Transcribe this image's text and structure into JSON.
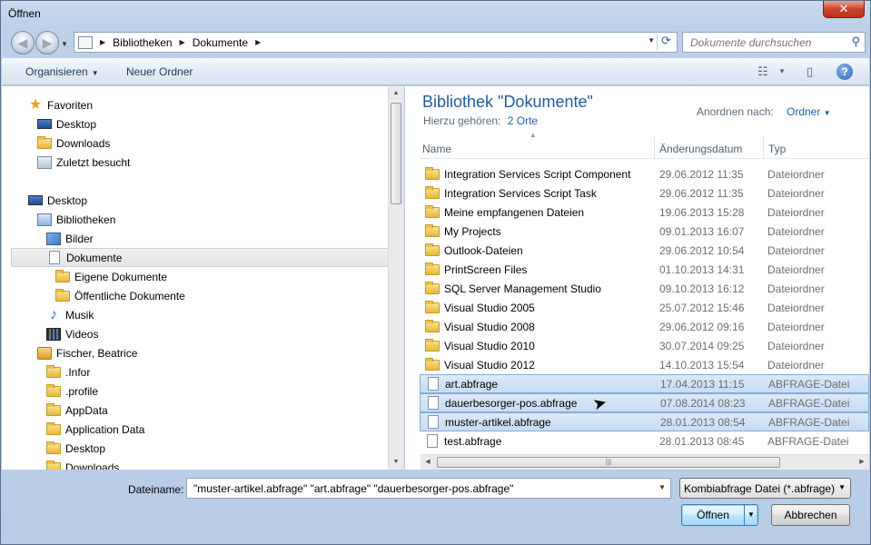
{
  "window": {
    "title": "Öffnen",
    "close_label": "✕"
  },
  "nav": {
    "back_label": "◀",
    "forward_label": "▶",
    "crumbs": [
      "Bibliotheken",
      "Dokumente"
    ],
    "search_placeholder": "Dokumente durchsuchen"
  },
  "toolbar": {
    "organize_label": "Organisieren",
    "new_folder_label": "Neuer Ordner",
    "help_label": "?"
  },
  "tree": [
    {
      "label": "Favoriten",
      "icon": "star-icon"
    },
    {
      "label": "Desktop",
      "icon": "monitor-icon"
    },
    {
      "label": "Downloads",
      "icon": "folder-icon"
    },
    {
      "label": "Zuletzt besucht",
      "icon": "recent-places-icon"
    },
    {
      "label": "Desktop",
      "icon": "monitor-icon"
    },
    {
      "label": "Bibliotheken",
      "icon": "library-icon"
    },
    {
      "label": "Bilder",
      "icon": "pictures-icon"
    },
    {
      "label": "Dokumente",
      "icon": "document-icon"
    },
    {
      "label": "Eigene Dokumente",
      "icon": "folder-icon"
    },
    {
      "label": "Öffentliche Dokumente",
      "icon": "folder-icon"
    },
    {
      "label": "Musik",
      "icon": "music-icon"
    },
    {
      "label": "Videos",
      "icon": "video-icon"
    },
    {
      "label": "Fischer, Beatrice",
      "icon": "user-folder-icon"
    },
    {
      "label": ".Infor",
      "icon": "folder-icon"
    },
    {
      "label": ".profile",
      "icon": "folder-icon"
    },
    {
      "label": "AppData",
      "icon": "folder-icon"
    },
    {
      "label": "Application Data",
      "icon": "folder-icon"
    },
    {
      "label": "Desktop",
      "icon": "folder-icon"
    },
    {
      "label": "Downloads",
      "icon": "folder-icon"
    }
  ],
  "library": {
    "title": "Bibliothek \"Dokumente\"",
    "includes_label": "Hierzu gehören:",
    "includes_link": "2 Orte",
    "arrange_label": "Anordnen nach:",
    "arrange_value": "Ordner"
  },
  "columns": {
    "name": "Name",
    "date": "Änderungsdatum",
    "type": "Typ"
  },
  "files": [
    {
      "name": "Integration Services Script Component",
      "date": "29.06.2012 11:35",
      "type": "Dateiordner",
      "kind": "folder",
      "selected": false
    },
    {
      "name": "Integration Services Script Task",
      "date": "29.06.2012 11:35",
      "type": "Dateiordner",
      "kind": "folder",
      "selected": false
    },
    {
      "name": "Meine empfangenen Dateien",
      "date": "19.06.2013 15:28",
      "type": "Dateiordner",
      "kind": "folder",
      "selected": false
    },
    {
      "name": "My Projects",
      "date": "09.01.2013 16:07",
      "type": "Dateiordner",
      "kind": "folder",
      "selected": false
    },
    {
      "name": "Outlook-Dateien",
      "date": "29.06.2012 10:54",
      "type": "Dateiordner",
      "kind": "folder",
      "selected": false
    },
    {
      "name": "PrintScreen Files",
      "date": "01.10.2013 14:31",
      "type": "Dateiordner",
      "kind": "folder",
      "selected": false
    },
    {
      "name": "SQL Server Management Studio",
      "date": "09.10.2013 16:12",
      "type": "Dateiordner",
      "kind": "folder",
      "selected": false
    },
    {
      "name": "Visual Studio 2005",
      "date": "25.07.2012 15:46",
      "type": "Dateiordner",
      "kind": "folder",
      "selected": false
    },
    {
      "name": "Visual Studio 2008",
      "date": "29.06.2012 09:16",
      "type": "Dateiordner",
      "kind": "folder",
      "selected": false
    },
    {
      "name": "Visual Studio 2010",
      "date": "30.07.2014 09:25",
      "type": "Dateiordner",
      "kind": "folder",
      "selected": false
    },
    {
      "name": "Visual Studio 2012",
      "date": "14.10.2013 15:54",
      "type": "Dateiordner",
      "kind": "folder",
      "selected": false
    },
    {
      "name": "art.abfrage",
      "date": "17.04.2013 11:15",
      "type": "ABFRAGE-Datei",
      "kind": "file",
      "selected": true
    },
    {
      "name": "dauerbesorger-pos.abfrage",
      "date": "07.08.2014 08:23",
      "type": "ABFRAGE-Datei",
      "kind": "file",
      "selected": true
    },
    {
      "name": "muster-artikel.abfrage",
      "date": "28.01.2013 08:54",
      "type": "ABFRAGE-Datei",
      "kind": "file",
      "selected": true
    },
    {
      "name": "test.abfrage",
      "date": "28.01.2013 08:45",
      "type": "ABFRAGE-Datei",
      "kind": "file",
      "selected": false
    }
  ],
  "footer": {
    "filename_label": "Dateiname:",
    "filename_value": "\"muster-artikel.abfrage\" \"art.abfrage\" \"dauerbesorger-pos.abfrage\"",
    "filter_value": "Kombiabfrage Datei (*.abfrage)",
    "open_label": "Öffnen",
    "cancel_label": "Abbrechen"
  },
  "colors": {
    "accent": "#1e5c9a",
    "selection": "#cce0f7",
    "link": "#1e5eb5"
  }
}
